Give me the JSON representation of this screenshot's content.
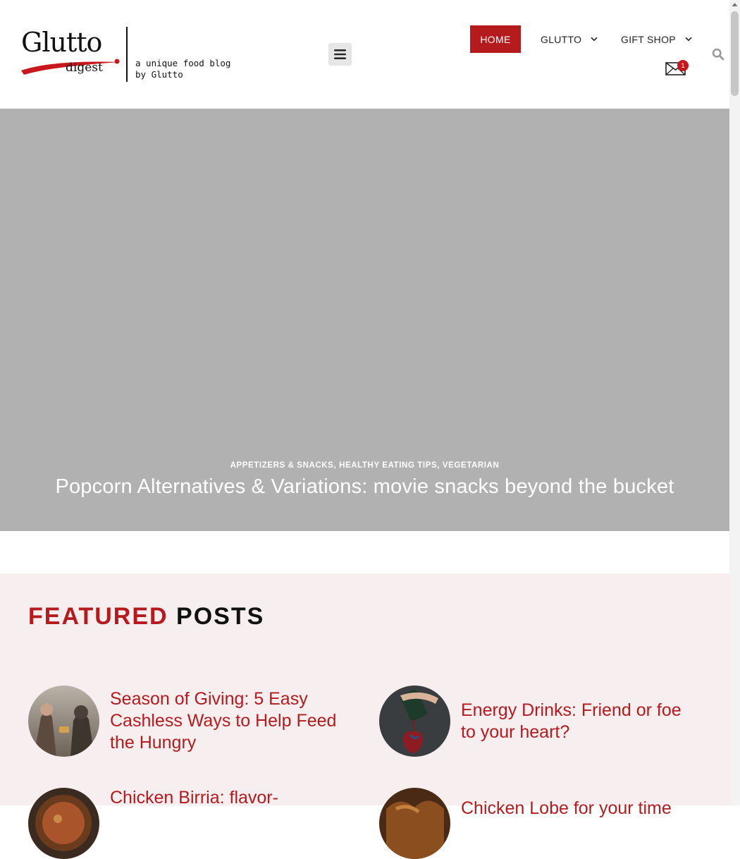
{
  "logo": {
    "word": "Glutto",
    "sub": "digest",
    "tagline_line1": "a unique food blog",
    "tagline_line2": "by Glutto"
  },
  "nav": {
    "items": [
      {
        "label": "HOME",
        "active": true
      },
      {
        "label": "GLUTTO",
        "has_dropdown": true
      },
      {
        "label": "GIFT SHOP",
        "has_dropdown": true
      }
    ],
    "menu_icon": "hamburger-icon",
    "search_icon": "search-icon",
    "mail_icon": "envelope-icon",
    "mail_badge": "1"
  },
  "hero": {
    "categories": [
      "APPETIZERS & SNACKS",
      "HEALTHY EATING TIPS",
      "VEGETARIAN"
    ],
    "title": "Popcorn Alternatives & Variations: movie snacks beyond the bucket"
  },
  "featured": {
    "heading_red": "FEATURED",
    "heading_dark": "POSTS",
    "posts": [
      {
        "title": "Season of Giving: 5 Easy Cashless Ways to Help Feed the Hungry"
      },
      {
        "title": "Energy Drinks: Friend or foe to your heart?"
      },
      {
        "title": "Chicken Birria: flavor-"
      },
      {
        "title": "Chicken Lobe for your time"
      }
    ]
  },
  "colors": {
    "accent": "#b51a1d",
    "hero_bg": "#b1b1b1",
    "featured_bg": "#f7eef0"
  }
}
